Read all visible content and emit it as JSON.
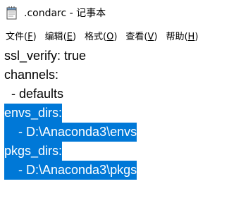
{
  "window": {
    "title": ".condarc - 记事本",
    "icon": "notepad-icon"
  },
  "menu": {
    "items": [
      {
        "label": "文件(",
        "accel": "F",
        "tail": ")"
      },
      {
        "label": "编辑(",
        "accel": "E",
        "tail": ")"
      },
      {
        "label": "格式(",
        "accel": "O",
        "tail": ")"
      },
      {
        "label": "查看(",
        "accel": "V",
        "tail": ")"
      },
      {
        "label": "帮助(",
        "accel": "H",
        "tail": ")"
      }
    ]
  },
  "editor": {
    "lines": [
      "ssl_verify: true",
      "channels:",
      "  - defaults",
      "envs_dirs:",
      "    - D:\\Anaconda3\\envs",
      "pkgs_dirs:",
      "    - D:\\Anaconda3\\pkgs"
    ],
    "selection_color": "#0078d7",
    "selection_text_color": "#ffffff"
  }
}
